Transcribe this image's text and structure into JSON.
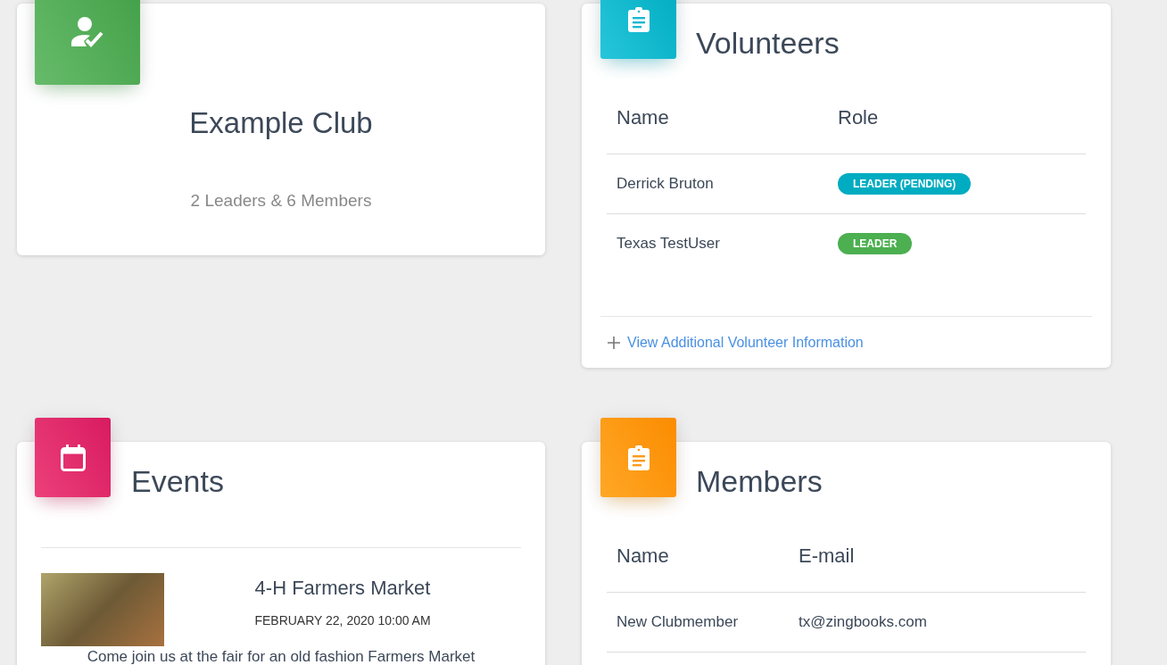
{
  "club_card": {
    "title": "Example Club",
    "summary": "2 Leaders & 6 Members"
  },
  "volunteers": {
    "title": "Volunteers",
    "columns": [
      "Name",
      "Role"
    ],
    "rows": [
      {
        "name": "Derrick Bruton",
        "role": "LEADER (PENDING)",
        "color": "#00acc1"
      },
      {
        "name": "Texas TestUser",
        "role": "LEADER",
        "color": "#4caf50"
      }
    ],
    "link": "View Additional Volunteer Information"
  },
  "events": {
    "title": "Events",
    "items": [
      {
        "title": "4-H Farmers Market",
        "date": "FEBRUARY 22, 2020 10:00 AM",
        "description": "Come join us at the fair for an old fashion Farmers Market"
      }
    ]
  },
  "members": {
    "title": "Members",
    "columns": [
      "Name",
      "E-mail"
    ],
    "rows": [
      {
        "name": "New Clubmember",
        "email": "tx@zingbooks.com"
      }
    ]
  }
}
